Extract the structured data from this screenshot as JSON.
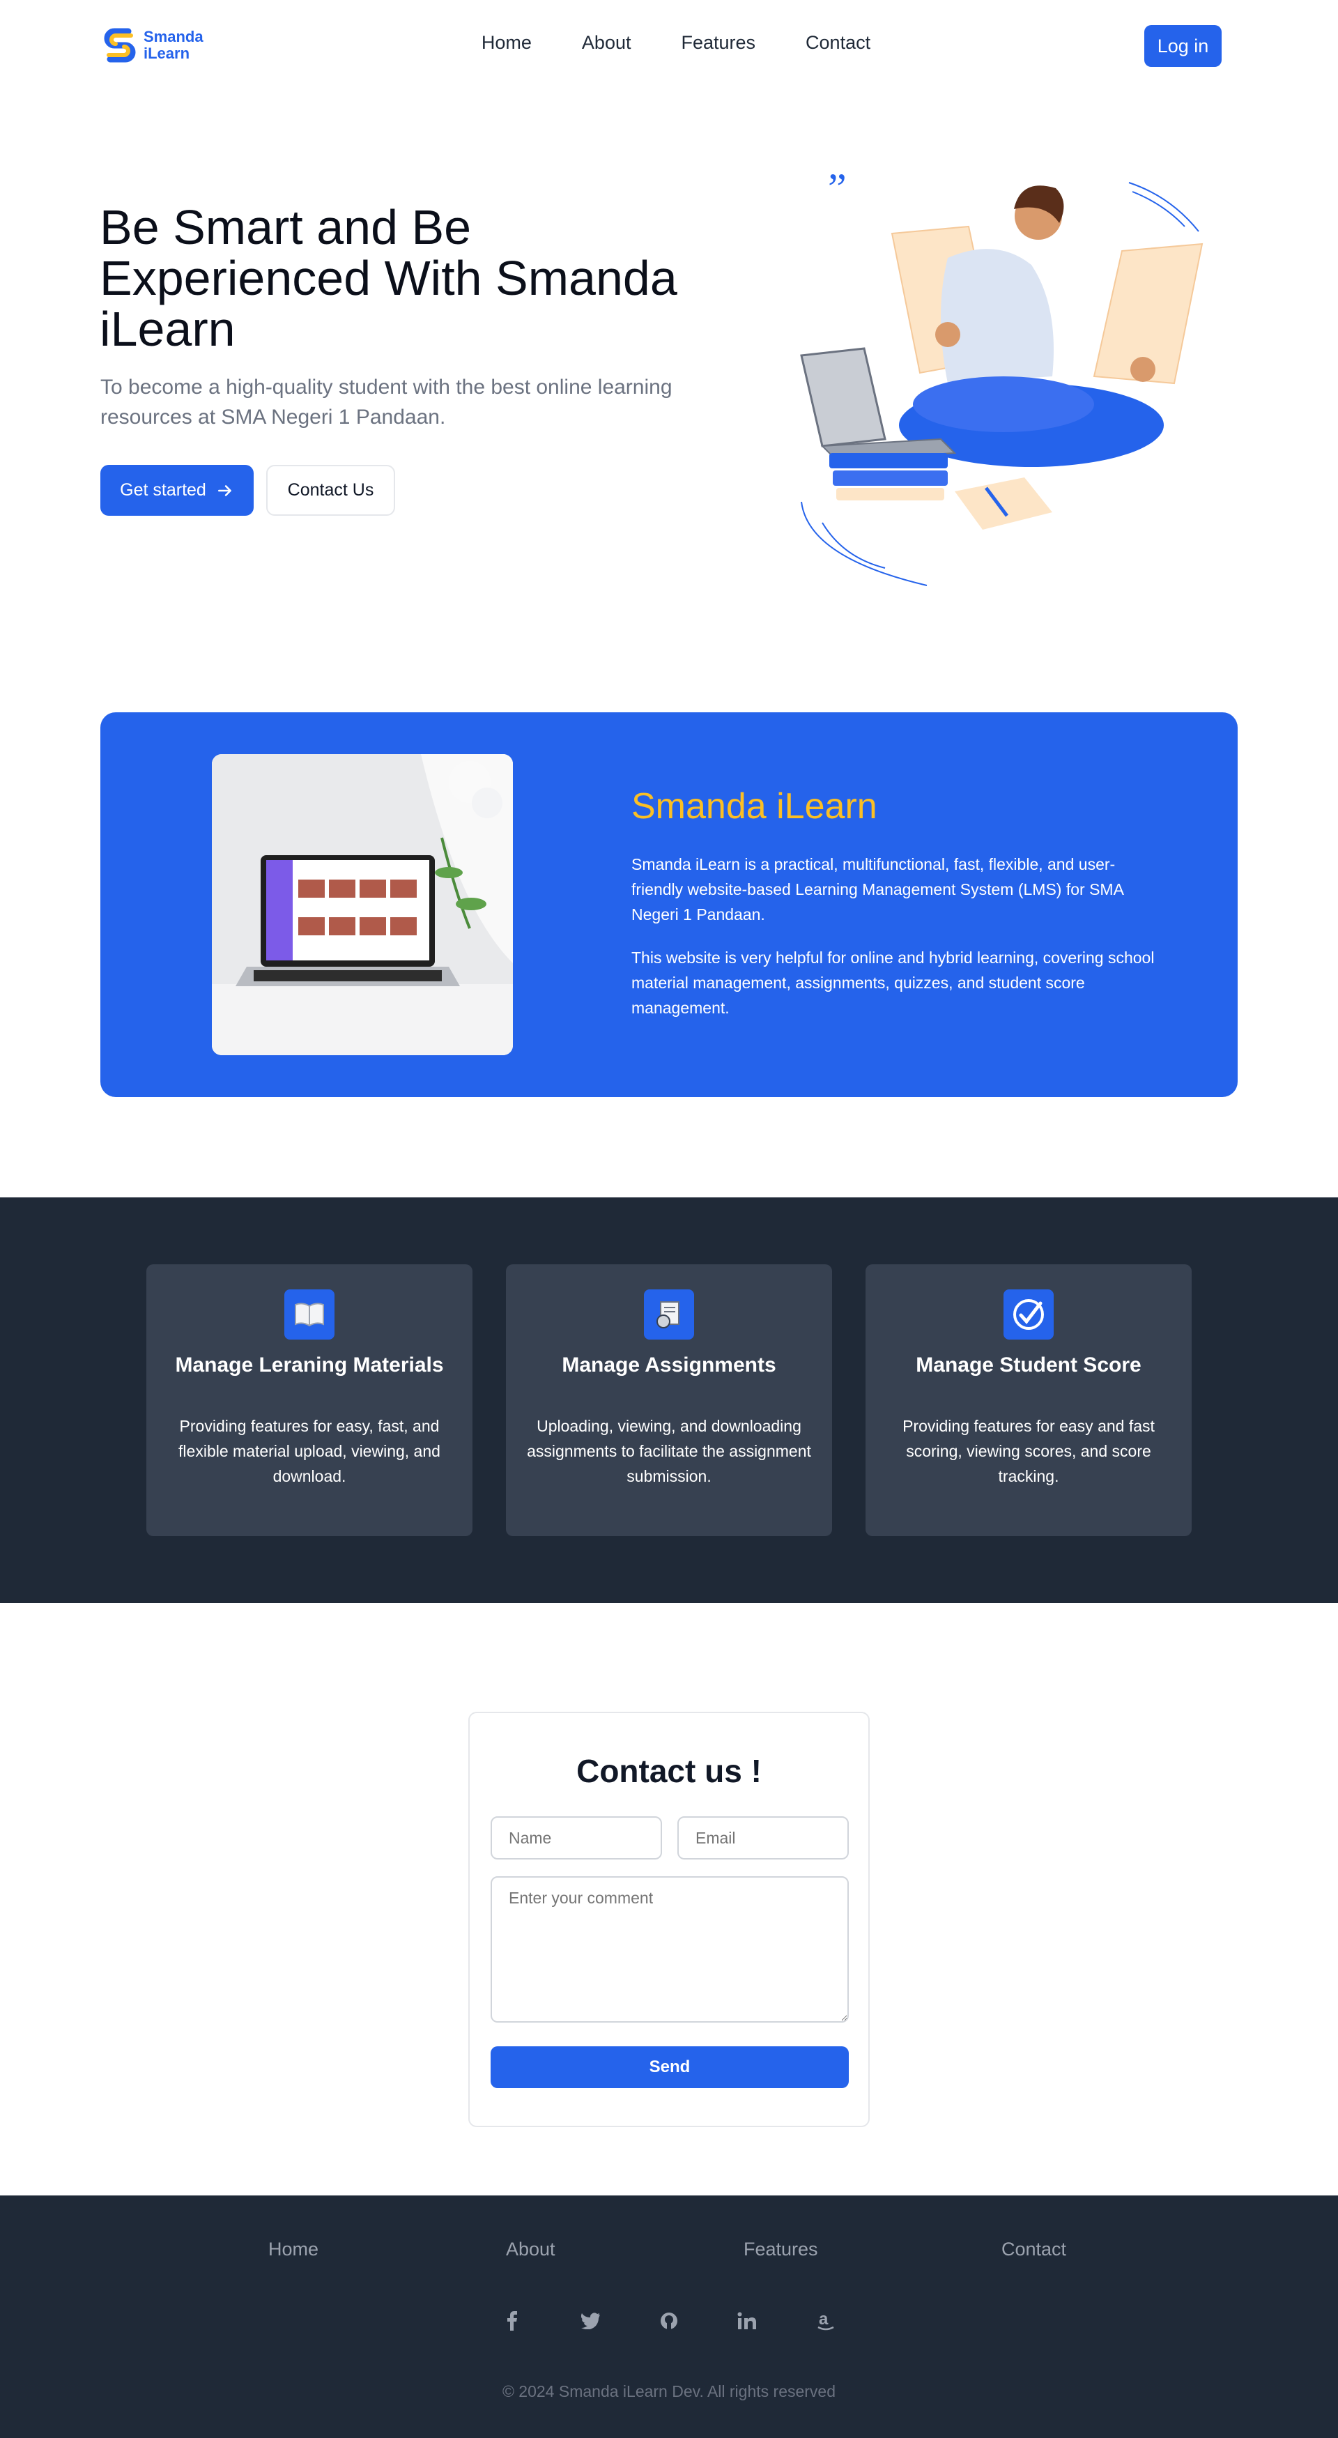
{
  "brand": {
    "name_line1": "Smanda",
    "name_line2": "iLearn",
    "primary_color": "#2563eb",
    "accent_color": "#fbbf24"
  },
  "nav": {
    "items": [
      "Home",
      "About",
      "Features",
      "Contact"
    ],
    "login_label": "Log in"
  },
  "hero": {
    "title": "Be Smart and Be Experienced With Smanda iLearn",
    "subtitle": "To become a high-quality student with the best online learning resources at SMA Negeri 1 Pandaan.",
    "primary_button": "Get started",
    "secondary_button": "Contact Us"
  },
  "about": {
    "title": "Smanda iLearn",
    "paragraph1": "Smanda iLearn is a practical, multifunctional, fast, flexible, and user-friendly website-based Learning Management System (LMS) for SMA Negeri 1 Pandaan.",
    "paragraph2": "This website is very helpful for online and hybrid learning, covering school material management, assignments, quizzes, and student score management."
  },
  "features": [
    {
      "icon": "book-icon",
      "title": "Manage Leraning Materials",
      "description": "Providing features for easy, fast, and flexible material upload, viewing, and download."
    },
    {
      "icon": "assignment-icon",
      "title": "Manage Assignments",
      "description": "Uploading, viewing, and downloading assignments to facilitate the assignment submission."
    },
    {
      "icon": "check-icon",
      "title": "Manage Student Score",
      "description": "Providing features for easy and fast scoring, viewing scores, and score tracking."
    }
  ],
  "contact": {
    "title": "Contact us !",
    "name_placeholder": "Name",
    "email_placeholder": "Email",
    "comment_placeholder": "Enter your comment",
    "send_label": "Send"
  },
  "footer": {
    "links": [
      "Home",
      "About",
      "Features",
      "Contact"
    ],
    "social_icons": [
      "facebook-icon",
      "twitter-icon",
      "github-icon",
      "linkedin-icon",
      "amazon-icon"
    ],
    "copyright": "© 2024 Smanda iLearn Dev. All rights reserved"
  }
}
